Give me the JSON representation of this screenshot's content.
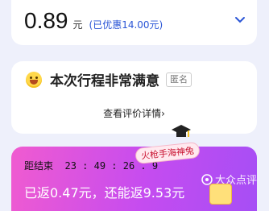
{
  "price": {
    "amount": "0.89",
    "unit": "元",
    "discount": "(已优惠14.00元)"
  },
  "rating": {
    "title": "本次行程非常满意",
    "anonymous": "匿名",
    "details": "查看评价详情"
  },
  "promo": {
    "countdown_label": "距结束",
    "countdown_time": "23 : 49 : 26 . 9",
    "rebate_text": "已返0.47元，还能返9.53元",
    "badge": "火枪手海神兔"
  },
  "watermark": "大众点评",
  "colors": {
    "accent_blue": "#2a55d6",
    "promo_start": "#f05bd0",
    "promo_end": "#a64ef5"
  }
}
